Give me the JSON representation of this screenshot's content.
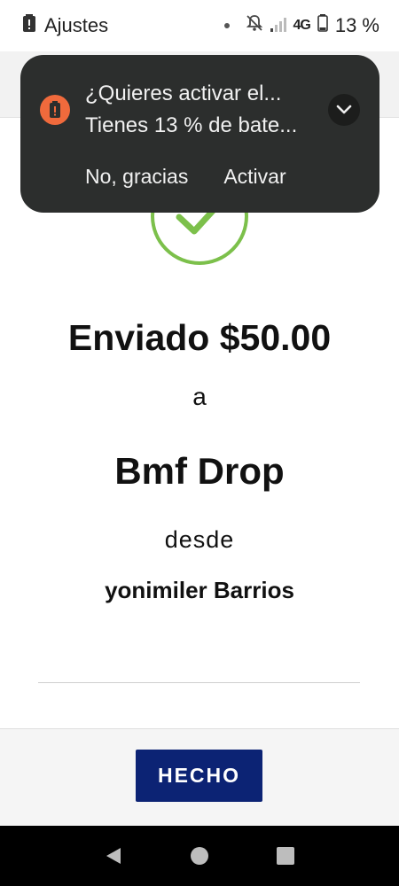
{
  "status_bar": {
    "app_label": "Ajustes",
    "network": "4G",
    "battery_percent": "13 %"
  },
  "notification": {
    "title": "¿Quieres activar el...",
    "text": "Tienes 13 % de bate...",
    "action_dismiss": "No, gracias",
    "action_accept": "Activar"
  },
  "receipt": {
    "amount_line": "Enviado $50.00",
    "to_word": "a",
    "recipient": "Bmf Drop",
    "from_word": "desde",
    "sender": "yonimiler Barrios"
  },
  "footer": {
    "done_label": "HECHO"
  },
  "colors": {
    "notification_bg": "#2c2e2d",
    "battery_saver_accent": "#f06a3c",
    "success_green": "#7cc04b",
    "primary_button": "#0c2374"
  }
}
